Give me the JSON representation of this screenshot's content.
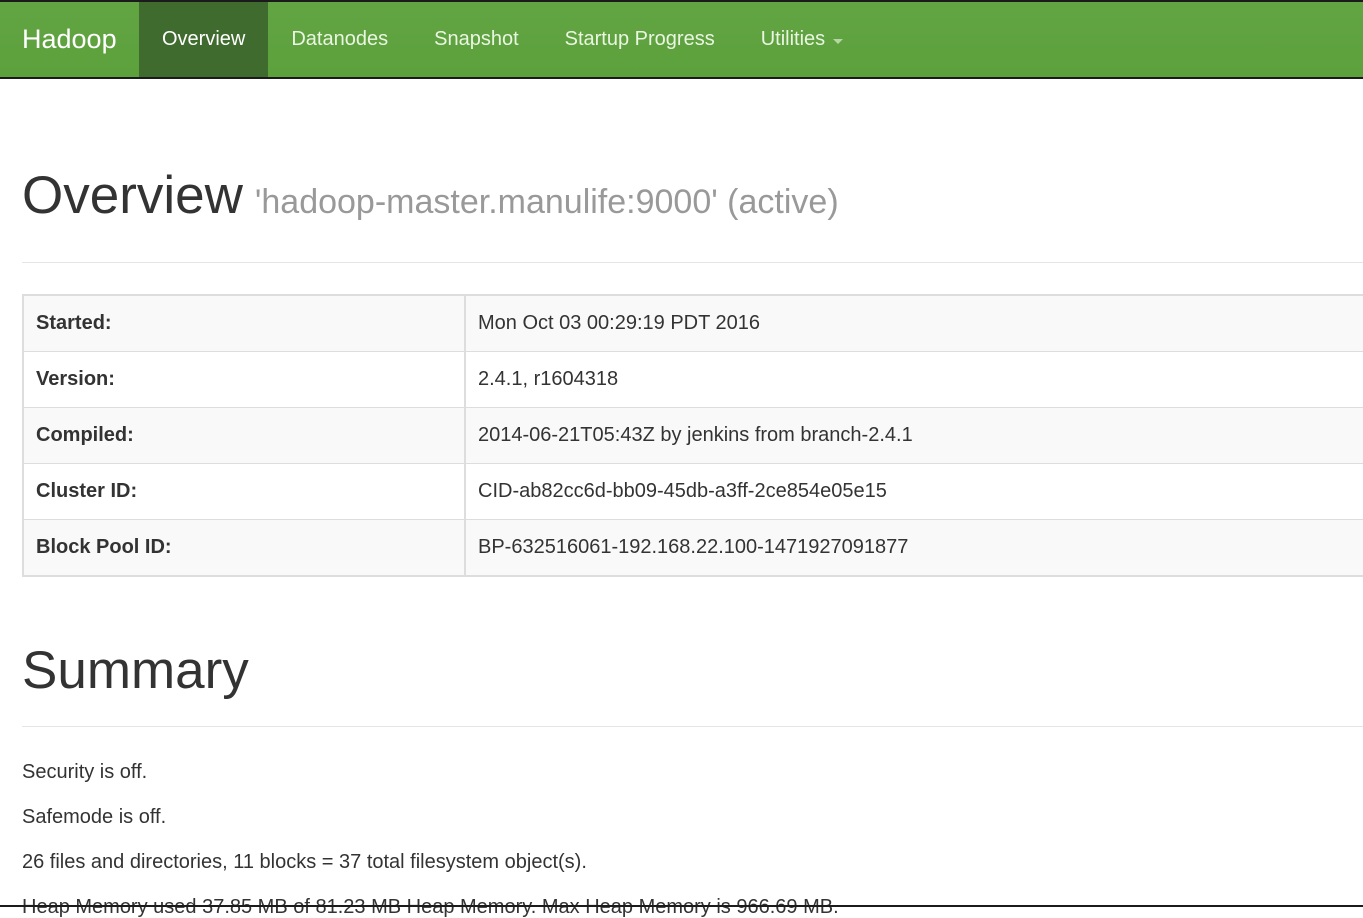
{
  "navbar": {
    "brand": "Hadoop",
    "items": [
      {
        "label": "Overview",
        "active": true
      },
      {
        "label": "Datanodes",
        "active": false
      },
      {
        "label": "Snapshot",
        "active": false
      },
      {
        "label": "Startup Progress",
        "active": false
      },
      {
        "label": "Utilities",
        "active": false,
        "dropdown": true
      }
    ],
    "colors": {
      "background": "#5ca13c",
      "active": "#3f6b2e"
    }
  },
  "overview": {
    "title": "Overview",
    "subtitle": "'hadoop-master.manulife:9000' (active)",
    "rows": [
      {
        "label": "Started:",
        "value": "Mon Oct 03 00:29:19 PDT 2016"
      },
      {
        "label": "Version:",
        "value": "2.4.1, r1604318"
      },
      {
        "label": "Compiled:",
        "value": "2014-06-21T05:43Z by jenkins from branch-2.4.1"
      },
      {
        "label": "Cluster ID:",
        "value": "CID-ab82cc6d-bb09-45db-a3ff-2ce854e05e15"
      },
      {
        "label": "Block Pool ID:",
        "value": "BP-632516061-192.168.22.100-1471927091877"
      }
    ]
  },
  "summary": {
    "title": "Summary",
    "security": "Security is off.",
    "safemode": "Safemode is off.",
    "filesystem": "26 files and directories, 11 blocks = 37 total filesystem object(s).",
    "heap": "Heap Memory used 37.85 MB of 81.23 MB Heap Memory. Max Heap Memory is 966.69 MB."
  }
}
